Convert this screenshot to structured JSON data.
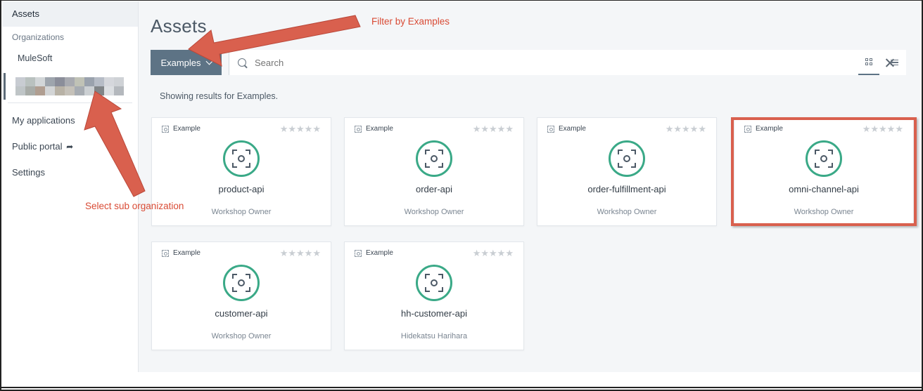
{
  "sidebar": {
    "assets_label": "Assets",
    "organizations_label": "Organizations",
    "org_name": "MuleSoft",
    "links": {
      "my_applications": "My applications",
      "public_portal": "Public portal",
      "settings": "Settings"
    }
  },
  "main": {
    "title": "Assets",
    "filter_button": "Examples",
    "search": {
      "value": "Search",
      "placeholder": "Search"
    },
    "results_text": "Showing results for Examples.",
    "cards": [
      {
        "type": "Example",
        "stars": "★★★★★",
        "name": "product-api",
        "owner": "Workshop Owner"
      },
      {
        "type": "Example",
        "stars": "★★★★★",
        "name": "order-api",
        "owner": "Workshop Owner"
      },
      {
        "type": "Example",
        "stars": "★★★★★",
        "name": "order-fulfillment-api",
        "owner": "Workshop Owner"
      },
      {
        "type": "Example",
        "stars": "★★★★★",
        "name": "omni-channel-api",
        "owner": "Workshop Owner"
      },
      {
        "type": "Example",
        "stars": "★★★★★",
        "name": "customer-api",
        "owner": "Workshop Owner"
      },
      {
        "type": "Example",
        "stars": "★★★★★",
        "name": "hh-customer-api",
        "owner": "Hidekatsu Harihara"
      }
    ]
  },
  "annotations": {
    "filter": "Filter by Examples",
    "sub_org": "Select sub organization",
    "color": "#d9604e"
  },
  "colors": {
    "accent": "#3aa987",
    "filter_button_bg": "#5d7385",
    "background": "#f4f6f8"
  },
  "icons": {
    "asset": "example-asset-icon",
    "search": "search-icon",
    "clear": "close-icon",
    "grid_view": "grid-view-icon",
    "list_view": "list-view-icon",
    "external": "external-link-icon"
  }
}
